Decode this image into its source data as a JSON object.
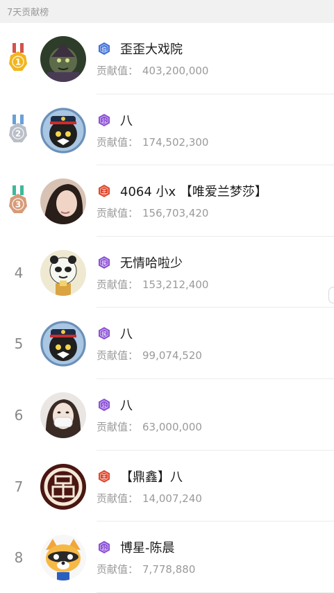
{
  "header": {
    "title": "7天贡献榜"
  },
  "score_label": "贡献值：",
  "colors": {
    "gold": "#f2b51c",
    "silver": "#b9bec7",
    "bronze": "#d79b78",
    "badge_blue": "#3f6fd8",
    "badge_purple": "#8a4fd6",
    "badge_red": "#e0462c"
  },
  "rows": [
    {
      "rank": "1",
      "medal": "gold",
      "badge_char": "伯",
      "badge_color": "blue",
      "name": "歪歪大戏院",
      "score": "403,200,000",
      "avatar": "warrior-avatar"
    },
    {
      "rank": "2",
      "medal": "silver",
      "badge_char": "公",
      "badge_color": "purple",
      "name": "八",
      "score": "174,502,300",
      "avatar": "cat-captain-avatar"
    },
    {
      "rank": "3",
      "medal": "bronze",
      "badge_char": "王",
      "badge_color": "red",
      "name": "4064 小x 【唯爱兰梦莎】",
      "score": "156,703,420",
      "avatar": "woman-photo-avatar"
    },
    {
      "rank": "4",
      "medal": "",
      "badge_char": "侯",
      "badge_color": "purple",
      "name": "无情哈啦少",
      "score": "153,212,400",
      "avatar": "panda-meme-avatar"
    },
    {
      "rank": "5",
      "medal": "",
      "badge_char": "侯",
      "badge_color": "purple",
      "name": "八",
      "score": "99,074,520",
      "avatar": "cat-captain-avatar"
    },
    {
      "rank": "6",
      "medal": "",
      "badge_char": "公",
      "badge_color": "purple",
      "name": "八",
      "score": "63,000,000",
      "avatar": "masked-woman-avatar"
    },
    {
      "rank": "7",
      "medal": "",
      "badge_char": "王",
      "badge_color": "red",
      "name": "【鼎鑫】八",
      "score": "14,007,240",
      "avatar": "ding-logo-avatar"
    },
    {
      "rank": "8",
      "medal": "",
      "badge_char": "公",
      "badge_color": "purple",
      "name": "博星-陈晨",
      "score": "7,778,880",
      "avatar": "raccoon-avatar"
    }
  ]
}
